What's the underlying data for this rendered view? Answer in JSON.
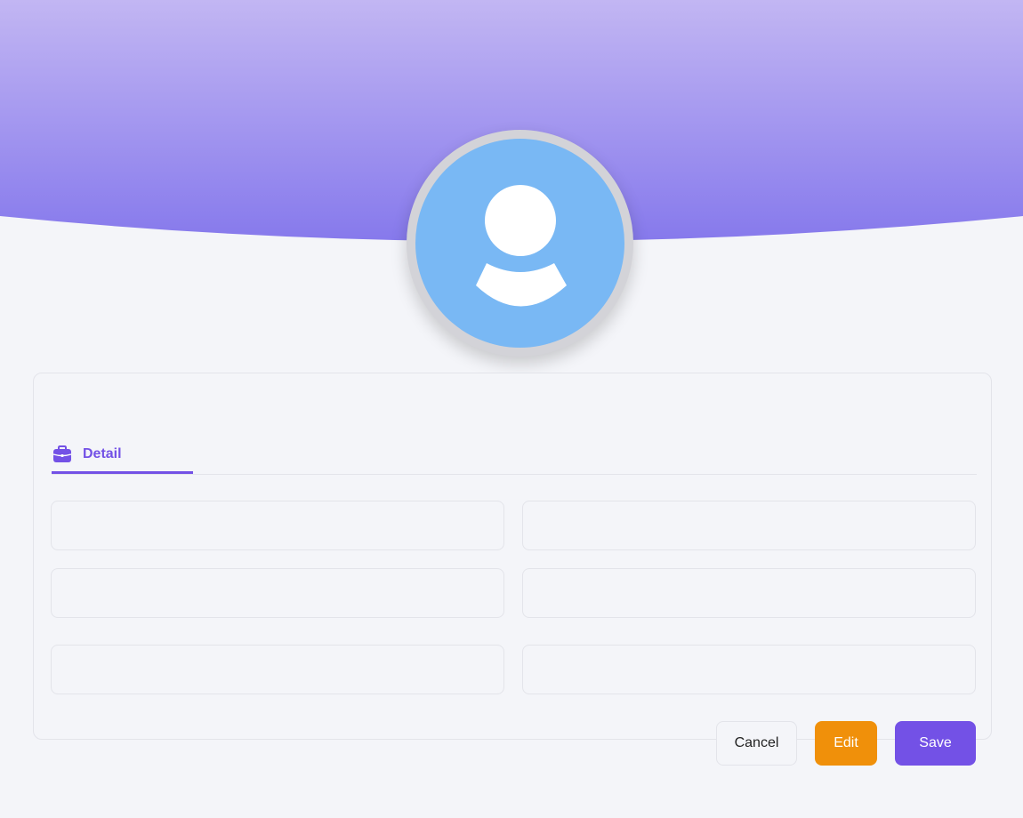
{
  "profile": {
    "avatar_icon": "user-icon",
    "header_gradient": [
      "#c2b6f3",
      "#8679ec"
    ],
    "avatar_color": "#79b8f4"
  },
  "tabs": [
    {
      "label": "Detail",
      "icon": "briefcase-icon",
      "active": true
    }
  ],
  "form": {
    "fields": [
      {
        "value": "",
        "placeholder": ""
      },
      {
        "value": "",
        "placeholder": ""
      },
      {
        "value": "",
        "placeholder": ""
      },
      {
        "value": "",
        "placeholder": ""
      },
      {
        "value": "",
        "placeholder": ""
      },
      {
        "value": "",
        "placeholder": ""
      }
    ]
  },
  "actions": {
    "cancel_label": "Cancel",
    "edit_label": "Edit",
    "save_label": "Save"
  },
  "colors": {
    "accent": "#7351e6",
    "edit": "#f0900a"
  }
}
